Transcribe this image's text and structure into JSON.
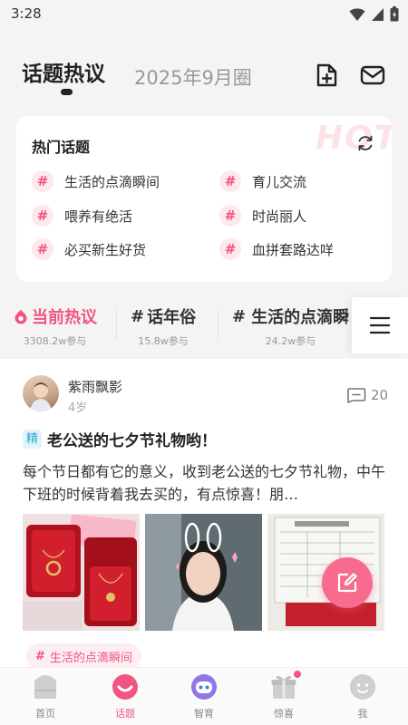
{
  "status_bar": {
    "time": "3:28"
  },
  "header": {
    "tab_topics": "话题热议",
    "tab_month": "2025年9月圈"
  },
  "hot_topics": {
    "title": "热门话题",
    "watermark": "HOT",
    "items": [
      {
        "label": "生活的点滴瞬间"
      },
      {
        "label": "育儿交流"
      },
      {
        "label": "喂养有绝活"
      },
      {
        "label": "时尚丽人"
      },
      {
        "label": "必买新生好货"
      },
      {
        "label": "血拼套路达咩"
      }
    ]
  },
  "topic_tabs": [
    {
      "title": "当前热议",
      "count": "3308.2w参与"
    },
    {
      "title": "话年俗",
      "count": "15.8w参与"
    },
    {
      "title": "生活的点滴瞬",
      "count": "24.2w参与"
    }
  ],
  "post": {
    "author": "紫雨飘影",
    "age": "4岁",
    "comments": "20",
    "badge": "精",
    "title": "老公送的七夕节礼物哟！",
    "excerpt": "每个节日都有它的意义，收到老公送的七夕节礼物，中午下班的时候背着我去买的，有点惊喜！朋…",
    "tag": "生活的点滴瞬间"
  },
  "bottom_nav": [
    {
      "label": "首页"
    },
    {
      "label": "话题"
    },
    {
      "label": "智育"
    },
    {
      "label": "惊喜"
    },
    {
      "label": "我"
    }
  ],
  "colors": {
    "accent": "#f0567f",
    "badge_blue": "#2aa6d2"
  }
}
